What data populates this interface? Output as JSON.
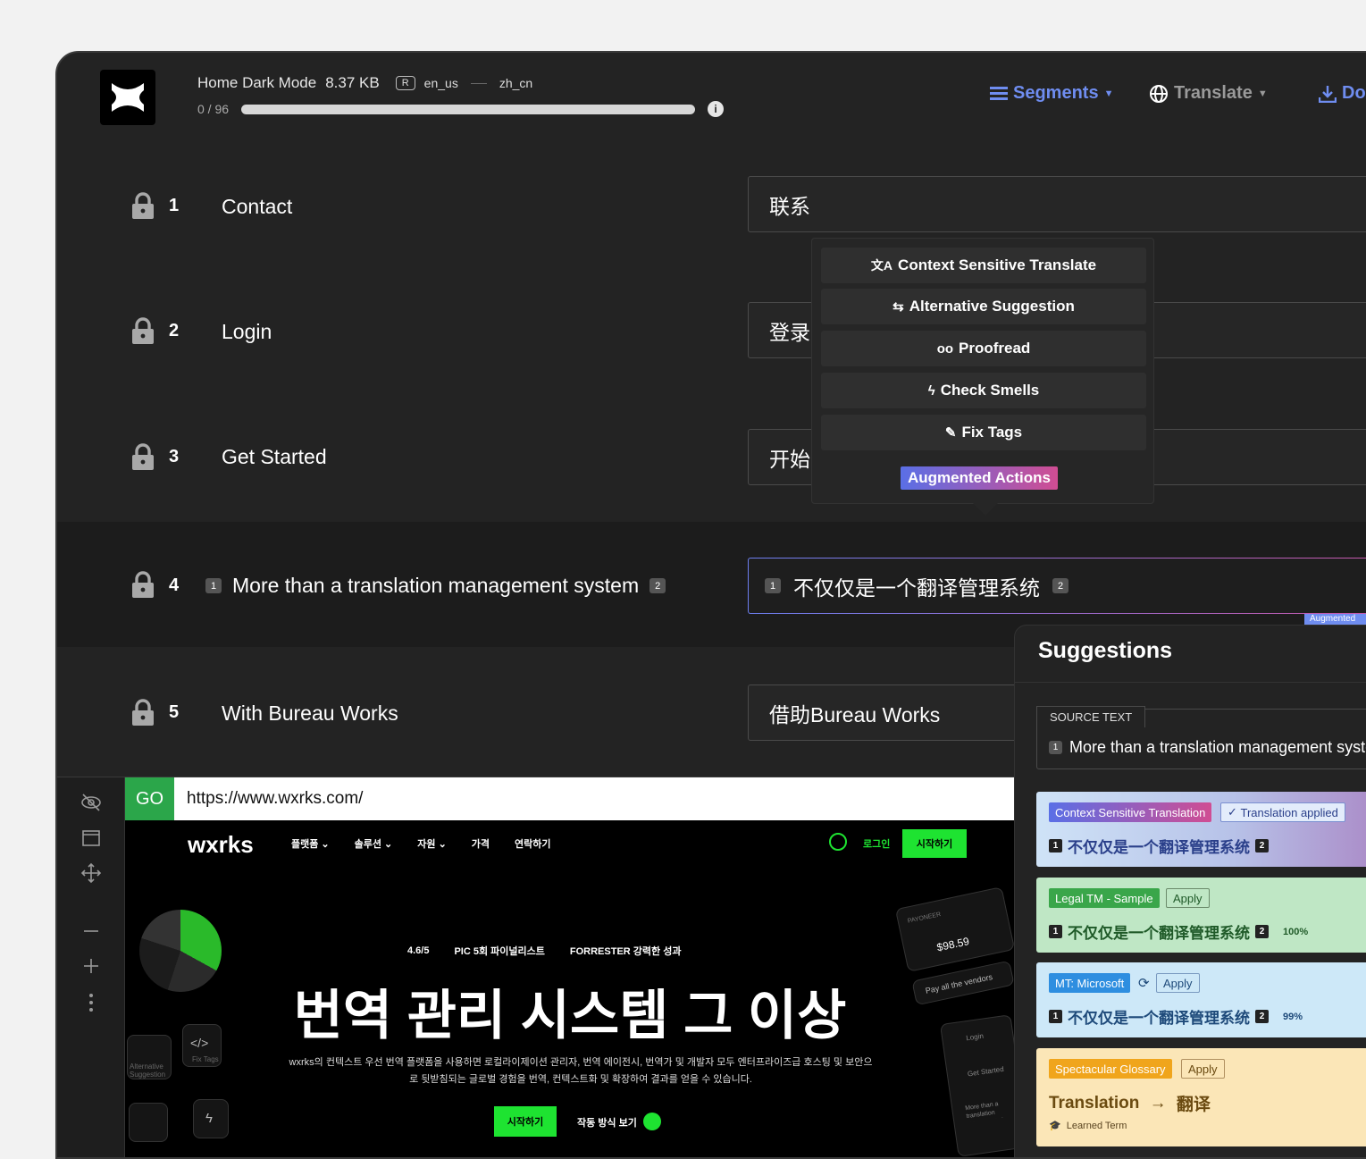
{
  "header": {
    "file_name": "Home Dark Mode",
    "file_size": "8.37 KB",
    "badge": "R",
    "source_lang": "en_us",
    "target_lang": "zh_cn",
    "progress_text": "0 / 96",
    "progress": 0.0,
    "info_icon": "i"
  },
  "nav": {
    "segments": "Segments",
    "translate": "Translate",
    "download": "Do"
  },
  "rows": [
    {
      "num": "1",
      "source": "Contact",
      "target": "联系"
    },
    {
      "num": "2",
      "source": "Login",
      "target": "登录"
    },
    {
      "num": "3",
      "source": "Get Started",
      "target": "开始"
    },
    {
      "num": "4",
      "source": "More than a translation management system",
      "target": "不仅仅是一个翻译管理系统",
      "tag_open": "1",
      "tag_close": "2"
    },
    {
      "num": "5",
      "source": "With Bureau Works",
      "target": "借助Bureau Works"
    }
  ],
  "popup": {
    "items": [
      "Context Sensitive Translate",
      "Alternative Suggestion",
      "Proofread",
      "Check Smells",
      "Fix Tags"
    ],
    "augmented": "Augmented Actions",
    "aug_under": "Augmented"
  },
  "preview": {
    "go": "GO",
    "url": "https://www.wxrks.com/",
    "site": {
      "logo": "wxrks",
      "nav": [
        "플랫폼 ⌄",
        "솔루션 ⌄",
        "자원 ⌄",
        "가격",
        "연락하기"
      ],
      "login": "로그인",
      "start": "시작하기",
      "badge_g2": "4.6/5",
      "badge_pic": "PIC 5회 파이널리스트",
      "badge_forrester": "FORRESTER 강력한 성과",
      "hero": "번역 관리 시스템 그 이상",
      "hero_p": "wxrks의 컨텍스트 우선 번역 플랫폼을 사용하면 로컬라이제이션 관리자, 번역 에이전시, 번역가 및 개발자 모두 엔터프라이즈급 호스팅 및 보안으로 뒷받침되는 글로벌 경험을 번역, 컨텍스트화 및 확장하여 결과를 얻을 수 있습니다.",
      "hero_btn": "시작하기",
      "hero_link": "작동 방식 보기",
      "card_amount": "$98.59",
      "card_label": "PAYONEER",
      "card_pay": "Pay all the vendors",
      "fix_tags": "Fix Tags",
      "alt_sugg": "Alternative Suggestion",
      "mini_login": "Login",
      "mini_started": "Get Started",
      "mini_more": "More than a translation management system"
    }
  },
  "suggestions": {
    "title": "Suggestions",
    "source_label": "SOURCE TEXT",
    "source_tag": "1",
    "source_text": "More than a translation management system",
    "cards": [
      {
        "chip": "Context Sensitive Translation",
        "chip2": "Translation applied",
        "text": "不仅仅是一个翻译管理系统"
      },
      {
        "chip": "Legal TM - Sample",
        "chip2": "Apply",
        "text": "不仅仅是一个翻译管理系统",
        "pct": "100%"
      },
      {
        "chip": "MT: Microsoft",
        "chip2": "Apply",
        "text": "不仅仅是一个翻译管理系统",
        "pct": "99%"
      },
      {
        "chip": "Spectacular Glossary",
        "chip2": "Apply",
        "term_src": "Translation",
        "term_tgt": "翻译",
        "learned": "Learned Term"
      }
    ]
  },
  "colors": {
    "bg": "#232323",
    "accent_blue": "#5a6fe6",
    "accent_pink": "#d04d93",
    "go_green": "#2ba64a",
    "site_green": "#1ee331"
  }
}
